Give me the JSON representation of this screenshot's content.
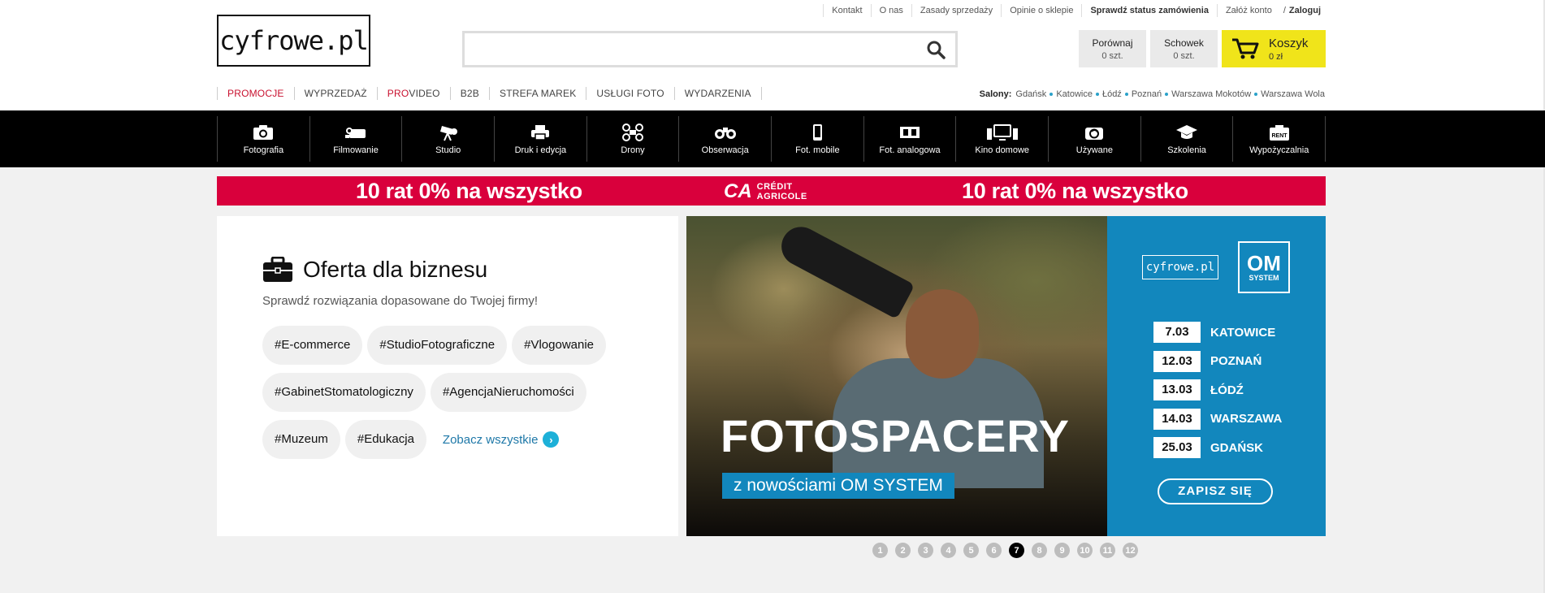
{
  "header": {
    "logo_text": "cyfrowe.pl",
    "util_links": [
      "Kontakt",
      "O nas",
      "Zasady sprzedaży",
      "Opinie o sklepie",
      "Sprawdź status zamówienia"
    ],
    "account_register": "Załóż konto",
    "account_sep": "/",
    "account_login": "Zaloguj",
    "search_placeholder": "",
    "compare_label": "Porównaj",
    "compare_count": "0 szt.",
    "wishlist_label": "Schowek",
    "wishlist_count": "0 szt.",
    "cart_label": "Koszyk",
    "cart_value": "0 zł",
    "accent_yellow": "#f0e41a"
  },
  "secondary_nav": {
    "items": [
      "PROMOCJE",
      "WYPRZEDAŻ",
      "PRO",
      "VIDEO",
      "B2B",
      "STREFA MAREK",
      "USŁUGI FOTO",
      "WYDARZENIA"
    ],
    "accent_red": "#c8102e"
  },
  "salony": {
    "label": "Salony:",
    "cities": [
      "Gdańsk",
      "Katowice",
      "Łódź",
      "Poznań",
      "Warszawa Mokotów",
      "Warszawa Wola"
    ]
  },
  "categories": [
    {
      "label": "Fotografia",
      "icon": "camera-icon"
    },
    {
      "label": "Filmowanie",
      "icon": "camcorder-icon"
    },
    {
      "label": "Studio",
      "icon": "studio-light-icon"
    },
    {
      "label": "Druk i edycja",
      "icon": "printer-icon"
    },
    {
      "label": "Drony",
      "icon": "drone-icon"
    },
    {
      "label": "Obserwacja",
      "icon": "binoculars-icon"
    },
    {
      "label": "Fot. mobile",
      "icon": "smartphone-icon"
    },
    {
      "label": "Fot. analogowa",
      "icon": "film-icon"
    },
    {
      "label": "Kino domowe",
      "icon": "home-cinema-icon"
    },
    {
      "label": "Używane",
      "icon": "used-camera-icon"
    },
    {
      "label": "Szkolenia",
      "icon": "graduation-cap-icon"
    },
    {
      "label": "Wypożyczalnia",
      "icon": "rent-icon"
    }
  ],
  "rent_icon_text": "RENT",
  "promo": {
    "text_left": "10 rat 0% na wszystko",
    "text_right": "10 rat 0% na wszystko",
    "bank_line1": "CRÉDIT",
    "bank_line2": "AGRICOLE",
    "color": "#d9003c"
  },
  "business": {
    "title": "Oferta dla biznesu",
    "subtitle": "Sprawdź rozwiązania dopasowane do Twojej firmy!",
    "tags": [
      "#E-commerce",
      "#StudioFotograficzne",
      "#Vlogowanie",
      "#GabinetStomatologiczny",
      "#AgencjaNieruchomości",
      "#Muzeum",
      "#Edukacja"
    ],
    "more_link": "Zobacz wszystkie"
  },
  "banner": {
    "title": "FOTOSPACERY",
    "subtitle": "z nowościami OM SYSTEM",
    "logo_cyfrowe": "cyfrowe.pl",
    "logo_om": "OM",
    "logo_system": "SYSTEM",
    "dates": [
      {
        "date": "7.03",
        "city": "KATOWICE"
      },
      {
        "date": "12.03",
        "city": "POZNAŃ"
      },
      {
        "date": "13.03",
        "city": "ŁÓDŹ"
      },
      {
        "date": "14.03",
        "city": "WARSZAWA"
      },
      {
        "date": "25.03",
        "city": "GDAŃSK"
      }
    ],
    "cta": "ZAPISZ SIĘ",
    "color": "#1287bd"
  },
  "pager": {
    "pages": [
      "1",
      "2",
      "3",
      "4",
      "5",
      "6",
      "7",
      "8",
      "9",
      "10",
      "11",
      "12"
    ],
    "active": "7"
  }
}
